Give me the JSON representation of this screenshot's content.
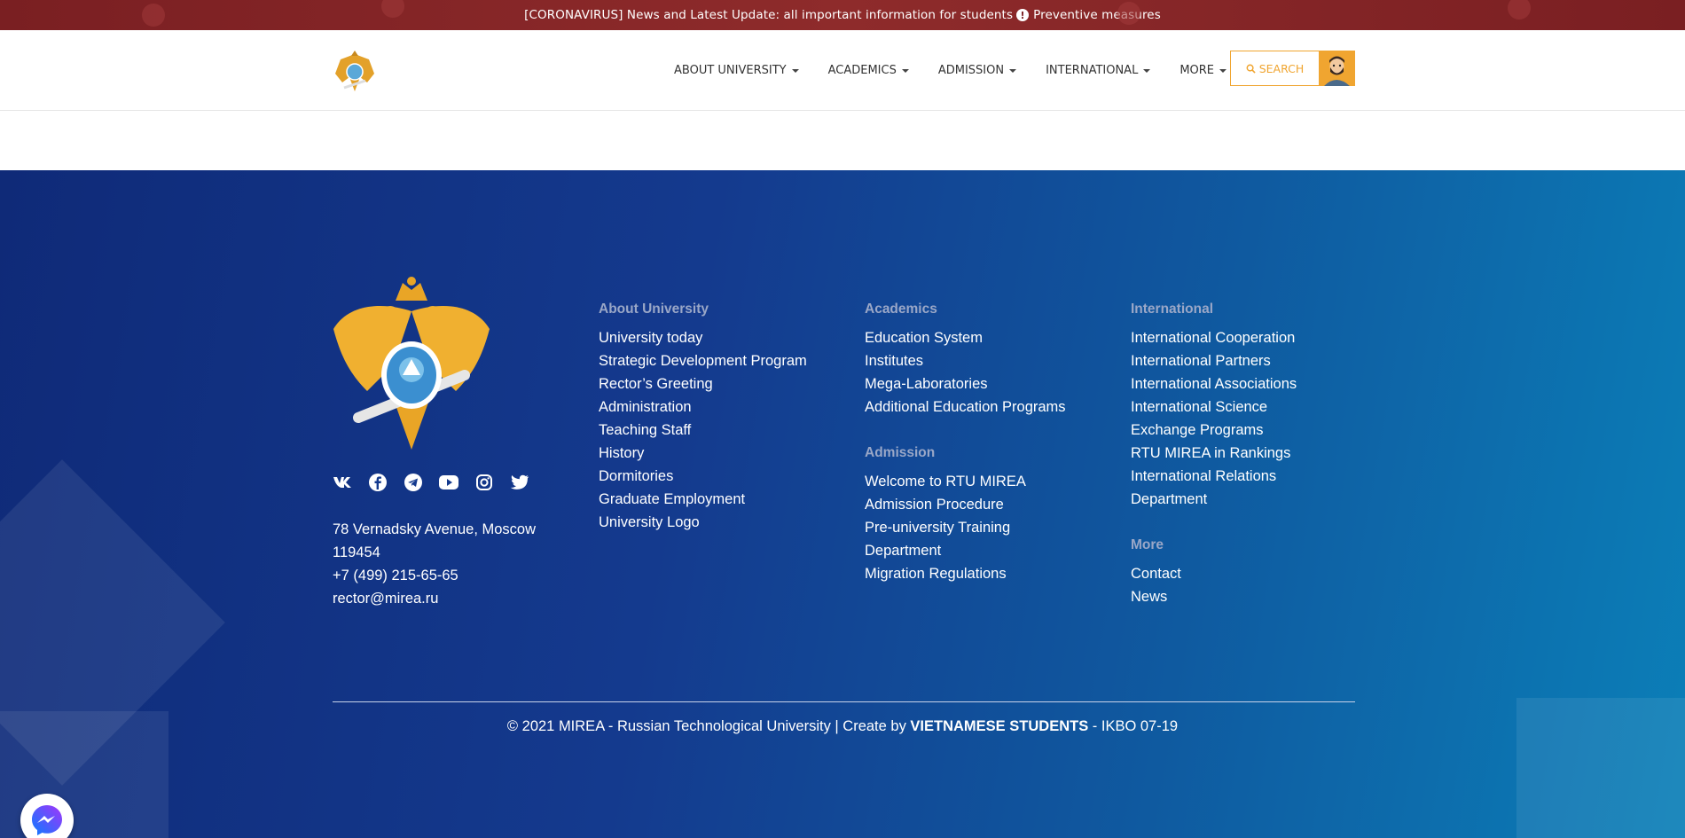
{
  "announcement": {
    "prefix": "[CORONAVIRUS] News and Latest Update: all important information for students",
    "link": "Preventive measures"
  },
  "nav": {
    "items": [
      {
        "label": "ABOUT UNIVERSITY"
      },
      {
        "label": "ACADEMICS"
      },
      {
        "label": "ADMISSION"
      },
      {
        "label": "INTERNATIONAL"
      },
      {
        "label": "MORE"
      }
    ],
    "search_label": "SEARCH"
  },
  "footer": {
    "address_line1": "78 Vernadsky Avenue, Moscow",
    "address_line2": "119454",
    "phone": "+7 (499) 215-65-65",
    "email": "rector@mirea.ru",
    "about": {
      "title": "About University",
      "links": [
        "University today",
        "Strategic Development Program",
        "Rector’s Greeting",
        "Administration",
        "Teaching Staff",
        "History",
        "Dormitories",
        "Graduate Employment",
        "University Logo"
      ]
    },
    "academics": {
      "title": "Academics",
      "links": [
        "Education System",
        "Institutes",
        "Mega-Laboratories",
        "Additional Education Programs"
      ]
    },
    "admission": {
      "title": "Admission",
      "links": [
        "Welcome to RTU MIREA",
        "Admission Procedure",
        "Pre-university Training",
        "Department",
        "Migration Regulations"
      ]
    },
    "international": {
      "title": "International",
      "links": [
        "International Cooperation",
        "International Partners",
        "International Associations",
        "International Science",
        "Exchange Programs",
        "RTU MIREA in Rankings",
        "International Relations",
        "Department"
      ]
    },
    "more": {
      "title": "More",
      "links": [
        "Contact",
        "News"
      ]
    },
    "copyright_pre": "© 2021 MIREA - Russian Technological University | Create by ",
    "copyright_bold": "VIETNAMESE STUDENTS",
    "copyright_post": " - IKBO 07-19"
  },
  "colors": {
    "topbar": "#7a1f22",
    "accent": "#f0a530",
    "footer_start": "#0f2a78",
    "footer_end": "#0b7fb8"
  },
  "icons": {
    "socials": [
      "vk-icon",
      "facebook-icon",
      "telegram-icon",
      "youtube-icon",
      "instagram-icon",
      "twitter-icon"
    ],
    "chat": "messenger-icon"
  }
}
